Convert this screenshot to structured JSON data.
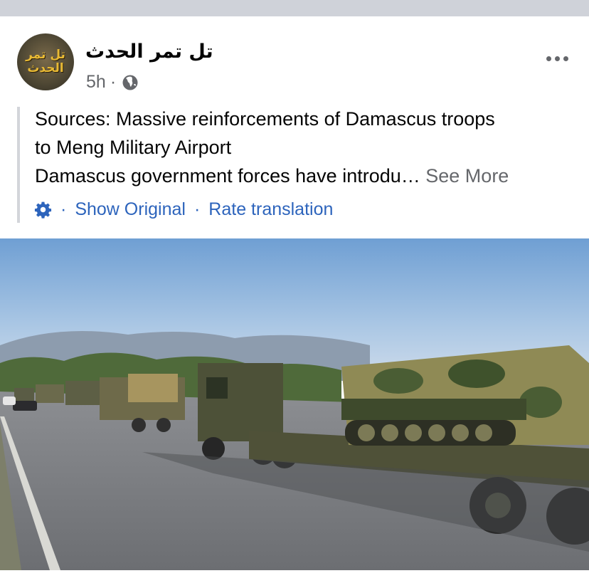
{
  "post": {
    "avatar_text": "تل تمر الحدث",
    "page_name": "تل تمر الحدث",
    "time": "5h",
    "separator": "·",
    "body_line1": "Sources: Massive reinforcements of Damascus troops",
    "body_line2": "to Meng Military Airport",
    "body_line3": "Damascus government forces have introdu… ",
    "see_more": "See More",
    "show_original": "Show Original",
    "rate_translation": "Rate translation"
  },
  "icons": {
    "globe": "globe-icon",
    "more": "more-options-icon",
    "gear": "gear-icon"
  },
  "colors": {
    "link": "#2d64bc",
    "secondary_text": "#65676b",
    "top_band": "#cfd2d9"
  }
}
